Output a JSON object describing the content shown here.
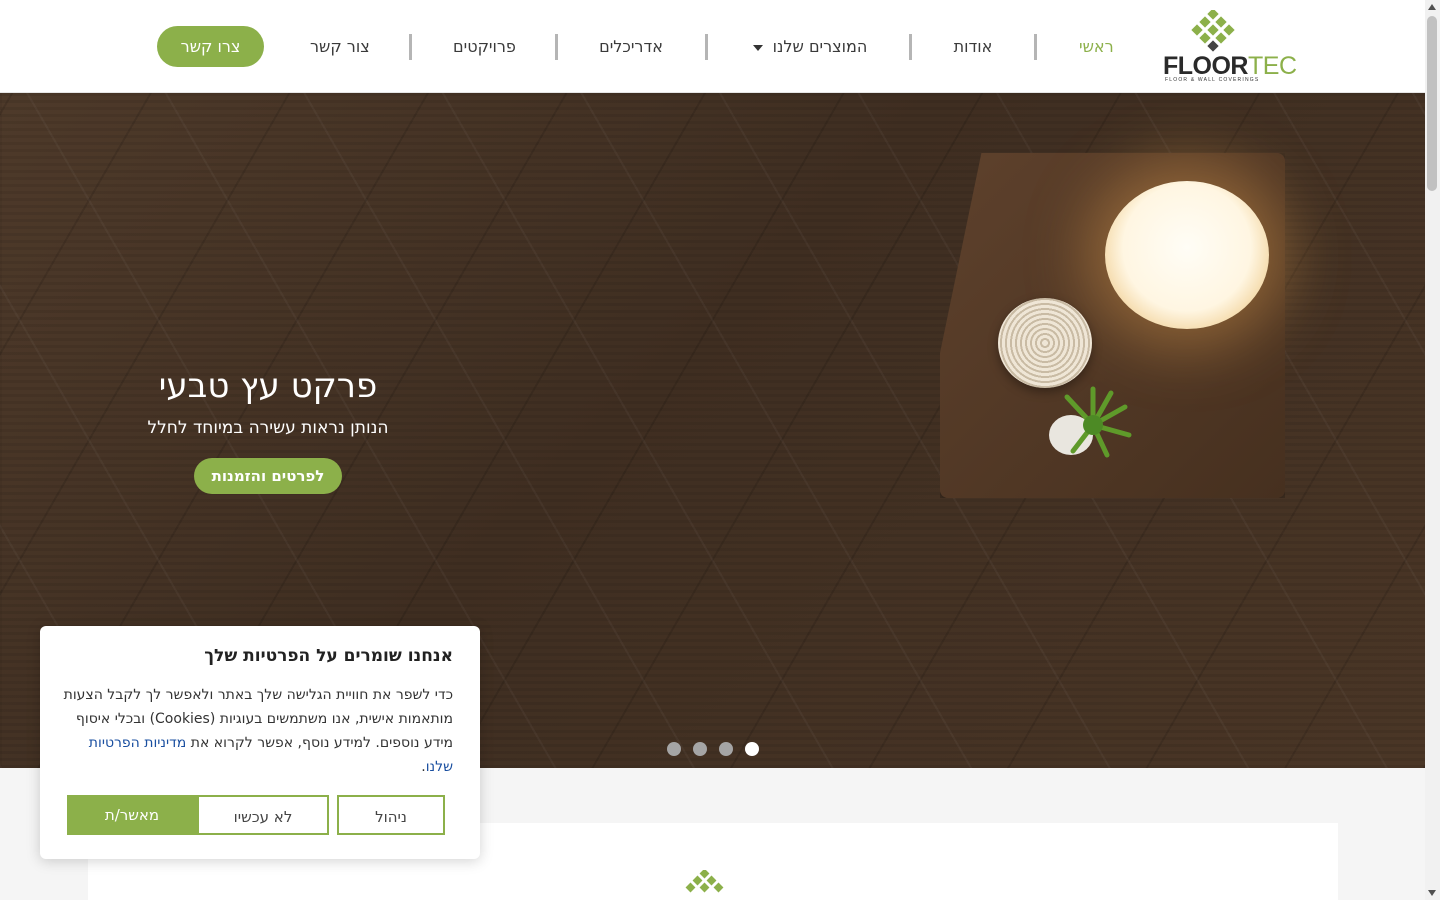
{
  "brand": {
    "name_dark": "FLOOR",
    "name_accent": "TEC",
    "tagline": "FLOOR & WALL COVERINGS",
    "accent_color": "#8cb04a"
  },
  "nav": {
    "home": "ראשי",
    "about": "אודות",
    "products": "המוצרים שלנו",
    "architects": "אדריכלים",
    "projects": "פרויקטים",
    "contact": "צור קשר",
    "cta": "צרו קשר"
  },
  "hero": {
    "title": "פרקט עץ טבעי",
    "subtitle": "הנותן נראות עשירה במיוחד לחלל",
    "button": "לפרטים והזמנות",
    "slide_count": 4,
    "active_slide": 1
  },
  "cookie": {
    "title": "אנחנו שומרים על הפרטיות שלך",
    "text": "כדי לשפר את חוויית הגלישה שלך באתר ולאפשר לך לקבל הצעות מותאמות אישית, אנו משתמשים בעוגיות (Cookies) ובכלי איסוף מידע נוספים. למידע נוסף, אפשר לקרוא את ",
    "link": "מדיניות הפרטיות שלנו",
    "period": ".",
    "accept": "מאשר/ת",
    "later": "לא עכשיו",
    "manage": "ניהול"
  },
  "icons": {
    "logo": "floortec-diamond-logo-icon",
    "dropdown": "caret-down-icon",
    "scroll_up": "scroll-up-arrow-icon",
    "scroll_down": "scroll-down-arrow-icon"
  }
}
